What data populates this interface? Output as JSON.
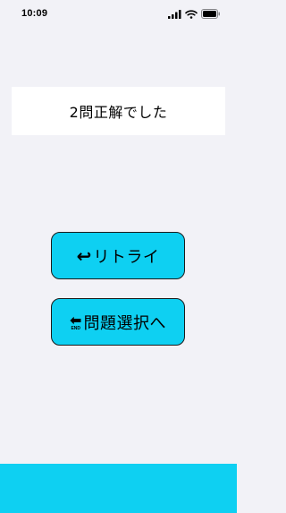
{
  "status_bar": {
    "time": "10:09",
    "icons": [
      "signal-icon",
      "wifi-icon",
      "battery-icon"
    ]
  },
  "result": {
    "message": "2問正解でした"
  },
  "buttons": {
    "retry": {
      "icon_glyph": "↩",
      "label": "リトライ"
    },
    "select": {
      "icon_glyph": "⬅",
      "icon_text": "END",
      "label": "問題選択へ"
    }
  },
  "colors": {
    "background": "#f2f2f7",
    "accent": "#0ed0f2",
    "card": "#ffffff"
  }
}
